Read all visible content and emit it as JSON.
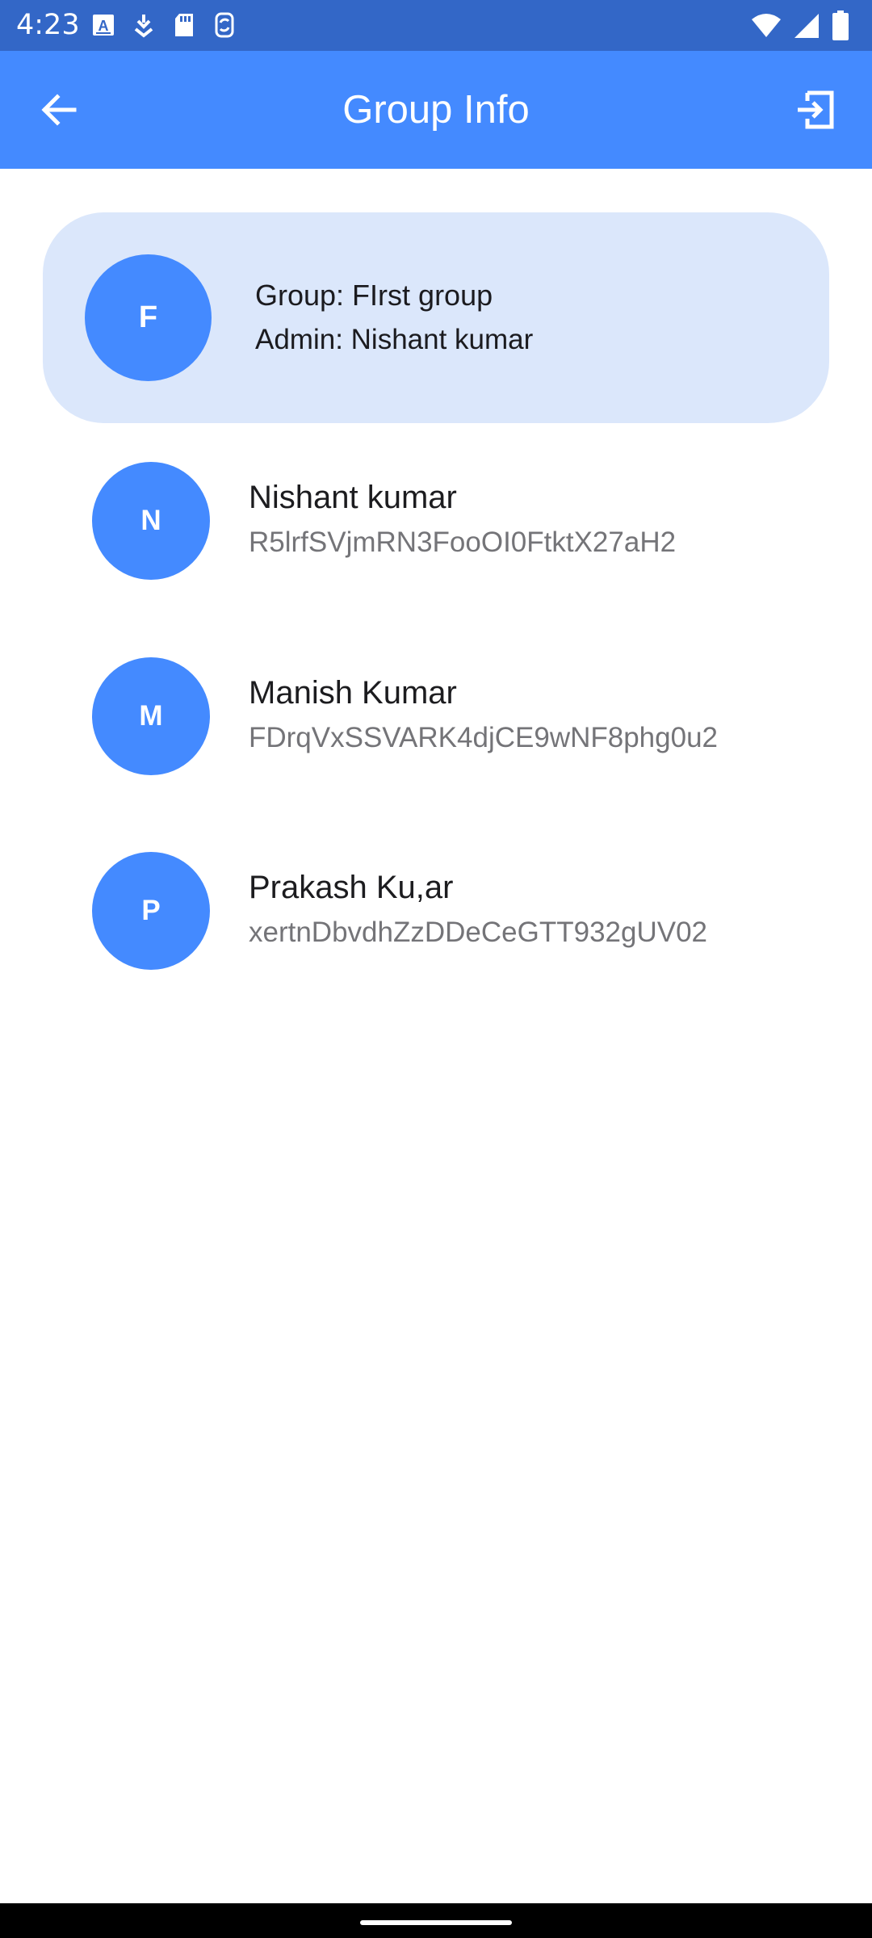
{
  "status_bar": {
    "time": "4:23",
    "left_icons": [
      "font-icon",
      "download-icon",
      "sd-card-icon",
      "sync-icon"
    ],
    "right_icons": [
      "wifi-icon",
      "signal-icon",
      "battery-icon"
    ]
  },
  "app_bar": {
    "title": "Group Info",
    "back_icon": "arrow-back-icon",
    "exit_icon": "exit-group-icon",
    "color": "#448aff"
  },
  "group": {
    "initial": "F",
    "name_line": "Group: FIrst group",
    "admin_line": "Admin: Nishant kumar",
    "card_color": "#dbe7fb"
  },
  "members": [
    {
      "initial": "N",
      "name": "Nishant kumar",
      "id": "R5lrfSVjmRN3FooOI0FtktX27aH2"
    },
    {
      "initial": "M",
      "name": "Manish Kumar",
      "id": "FDrqVxSSVARK4djCE9wNF8phg0u2"
    },
    {
      "initial": "P",
      "name": "Prakash Ku,ar",
      "id": "xertnDbvdhZzDDeCeGTT932gUV02"
    }
  ],
  "colors": {
    "status_bar": "#3367c7",
    "avatar": "#448aff",
    "secondary_text": "#747478"
  }
}
